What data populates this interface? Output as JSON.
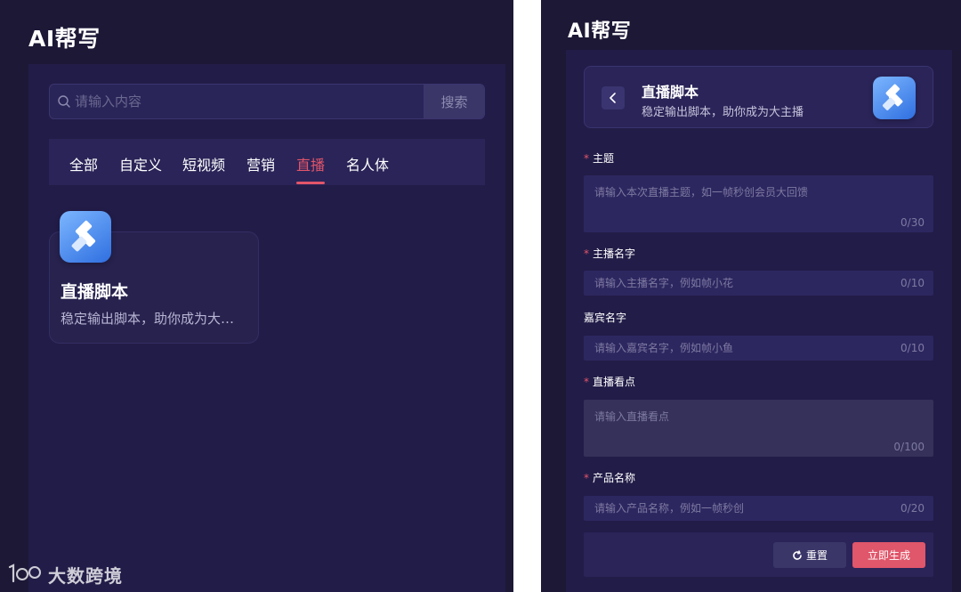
{
  "app_title": "AI帮写",
  "search": {
    "placeholder": "请输入内容",
    "button_label": "搜索"
  },
  "tabs": [
    {
      "label": "全部",
      "active": false
    },
    {
      "label": "自定义",
      "active": false
    },
    {
      "label": "短视频",
      "active": false
    },
    {
      "label": "营销",
      "active": false
    },
    {
      "label": "直播",
      "active": true
    },
    {
      "label": "名人体",
      "active": false
    }
  ],
  "card": {
    "title": "直播脚本",
    "description": "稳定输出脚本，助你成为大…",
    "icon": "app-tile-icon"
  },
  "watermark": {
    "logo_icon": "100-logo-icon",
    "text": "大数跨境"
  },
  "detail": {
    "title": "直播脚本",
    "subtitle": "稳定输出脚本，助你成为大主播",
    "back_icon": "chevron-left-icon"
  },
  "form": {
    "topic": {
      "label": "主题",
      "required": true,
      "placeholder": "请输入本次直播主题，如一帧秒创会员大回馈",
      "count": "0/30"
    },
    "host": {
      "label": "主播名字",
      "required": true,
      "placeholder": "请输入主播名字，例如帧小花",
      "count": "0/10"
    },
    "guest": {
      "label": "嘉宾名字",
      "required": false,
      "placeholder": "请输入嘉宾名字，例如帧小鱼",
      "count": "0/10"
    },
    "highlights": {
      "label": "直播看点",
      "required": true,
      "placeholder": "请输入直播看点",
      "count": "0/100"
    },
    "product": {
      "label": "产品名称",
      "required": true,
      "placeholder": "请输入产品名称，例如一帧秒创",
      "count": "0/20"
    }
  },
  "required_mark": "*",
  "buttons": {
    "reset_label": "重置",
    "generate_label": "立即生成"
  },
  "colors": {
    "accent": "#e2556a",
    "background": "#1c1836",
    "surface": "#221c48"
  }
}
